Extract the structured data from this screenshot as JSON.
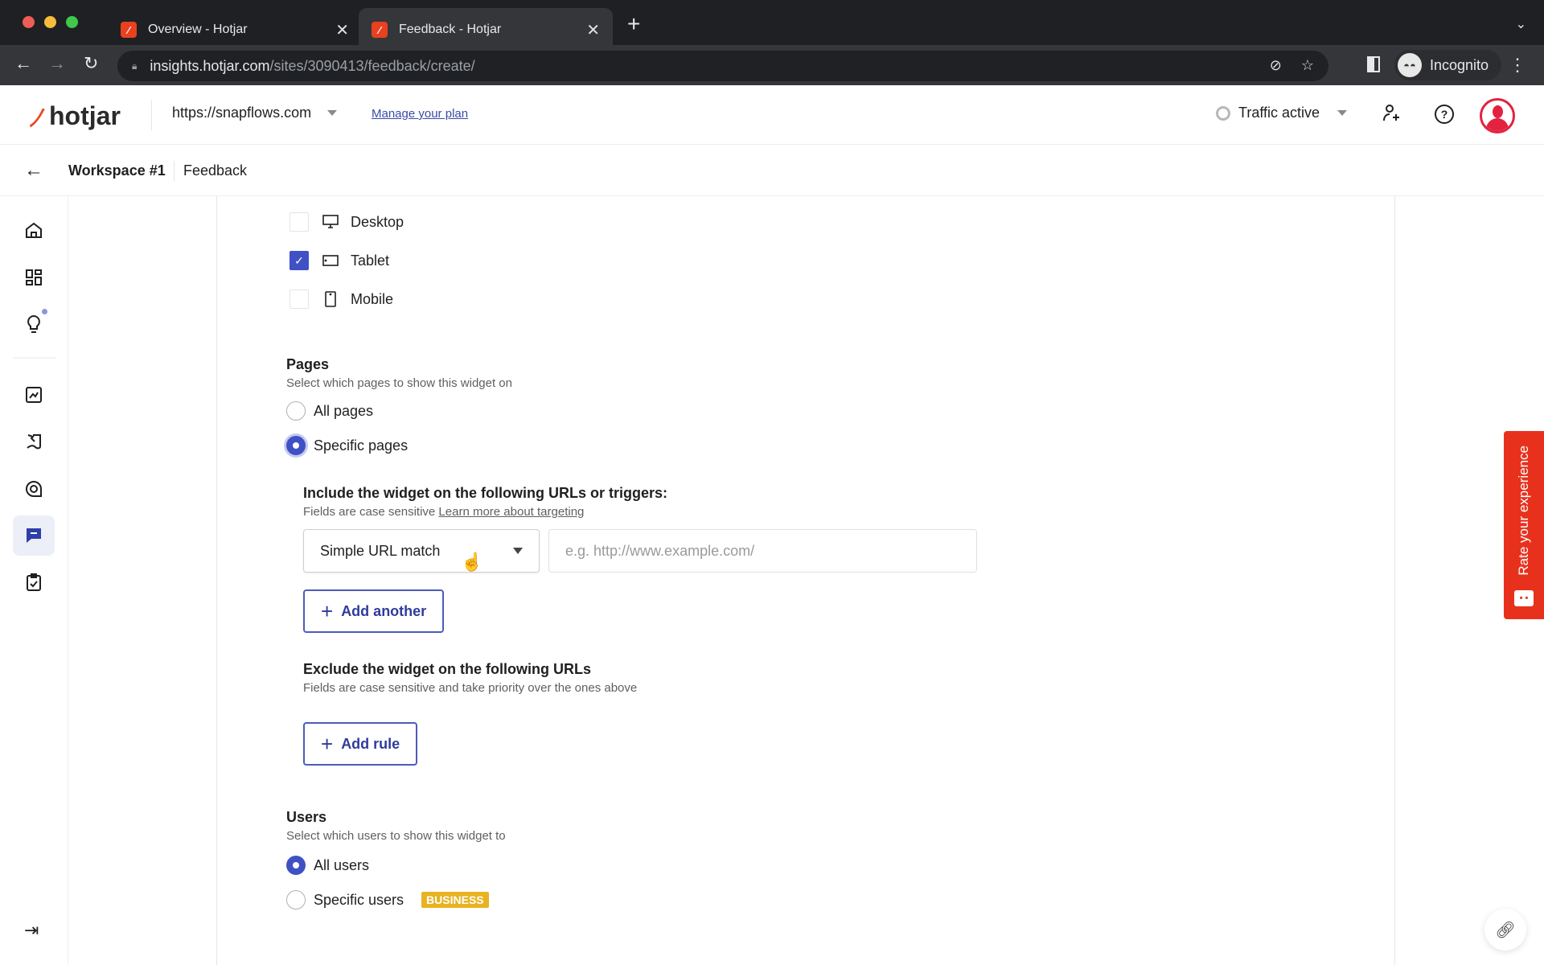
{
  "browser": {
    "tabs": [
      {
        "title": "Overview - Hotjar",
        "active": false
      },
      {
        "title": "Feedback - Hotjar",
        "active": true
      }
    ],
    "url_host": "insights.hotjar.com",
    "url_path": "/sites/3090413/feedback/create/",
    "profile_label": "Incognito"
  },
  "header": {
    "logo_text": "hotjar",
    "site_url": "https://snapflows.com",
    "manage_plan_link": "Manage your plan",
    "traffic_status": "Traffic active"
  },
  "breadcrumb": {
    "workspace": "Workspace #1",
    "page": "Feedback"
  },
  "sidebar": {
    "items": [
      {
        "icon": "home-icon",
        "active": false
      },
      {
        "icon": "dashboard-icon",
        "active": false
      },
      {
        "icon": "lightbulb-icon",
        "active": false,
        "notification": true
      },
      {
        "icon": "trends-icon",
        "active": false
      },
      {
        "icon": "heatmaps-icon",
        "active": false
      },
      {
        "icon": "recordings-icon",
        "active": false
      },
      {
        "icon": "feedback-icon",
        "active": true
      },
      {
        "icon": "surveys-icon",
        "active": false
      }
    ]
  },
  "devices": [
    {
      "label": "Desktop",
      "checked": false,
      "icon": "desktop-icon"
    },
    {
      "label": "Tablet",
      "checked": true,
      "icon": "tablet-icon"
    },
    {
      "label": "Mobile",
      "checked": false,
      "icon": "mobile-icon"
    }
  ],
  "pages": {
    "title": "Pages",
    "description": "Select which pages to show this widget on",
    "options": [
      {
        "label": "All pages",
        "selected": false
      },
      {
        "label": "Specific pages",
        "selected": true
      }
    ],
    "include": {
      "title": "Include the widget on the following URLs or triggers:",
      "description": "Fields are case sensitive",
      "learn_more_link": "Learn more about targeting",
      "match_type": "Simple URL match",
      "url_value": "",
      "url_placeholder": "e.g. http://www.example.com/",
      "add_button": "Add another"
    },
    "exclude": {
      "title": "Exclude the widget on the following URLs",
      "description": "Fields are case sensitive and take priority over the ones above",
      "add_button": "Add rule"
    }
  },
  "users": {
    "title": "Users",
    "description": "Select which users to show this widget to",
    "options": [
      {
        "label": "All users",
        "selected": true
      },
      {
        "label": "Specific users",
        "selected": false,
        "badge": "BUSINESS"
      }
    ]
  },
  "feedback_tab": {
    "label": "Rate your experience"
  },
  "colors": {
    "accent": "#3f51c4",
    "brand": "#ef4623",
    "badge": "#e8b220",
    "feedback_tab": "#e8311d"
  }
}
